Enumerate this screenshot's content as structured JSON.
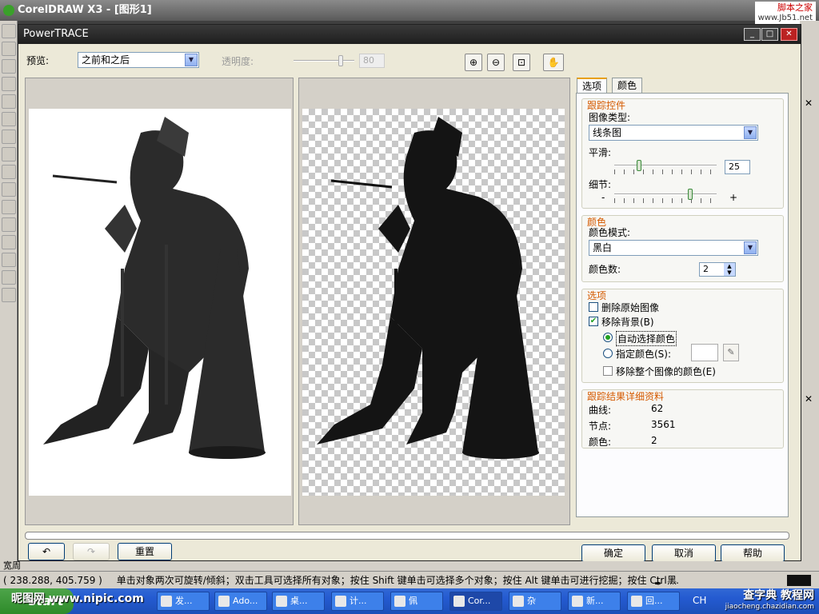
{
  "app": {
    "title": "CorelDRAW X3 - [图形1]",
    "watermark_top": "脚本之家",
    "watermark_url": "www.Jb51.net"
  },
  "dialog": {
    "title": "PowerTRACE",
    "preview_label": "预览:",
    "preview_value": "之前和之后",
    "transparency_label": "透明度:",
    "transparency_value": "80",
    "tabs": [
      "选项",
      "颜色"
    ],
    "trace_controls": {
      "title": "跟踪控件",
      "image_type_label": "图像类型:",
      "image_type_value": "线条图",
      "smoothing_label": "平滑:",
      "smoothing_value": "25",
      "detail_label": "细节:",
      "detail_minus": "-",
      "detail_plus": "+"
    },
    "color": {
      "title": "颜色",
      "mode_label": "颜色模式:",
      "mode_value": "黑白",
      "count_label": "颜色数:",
      "count_value": "2"
    },
    "options": {
      "title": "选项",
      "delete_original": "删除原始图像",
      "remove_background": "移除背景(B)",
      "auto_select": "自动选择颜色",
      "specify_color": "指定颜色(S):",
      "remove_entire": "移除整个图像的颜色(E)"
    },
    "results": {
      "title": "跟踪结果详细资料",
      "curves_label": "曲线:",
      "curves_value": "62",
      "nodes_label": "节点:",
      "nodes_value": "3561",
      "colors_label": "颜色:",
      "colors_value": "2"
    },
    "buttons": {
      "reset": "重置",
      "ok": "确定",
      "cancel": "取消",
      "help": "帮助"
    }
  },
  "below_dialog": "宽周",
  "status": {
    "coords": "( 238.288, 405.759 )",
    "hint": "单击对象两次可旋转/倾斜；双击工具可选择所有对象；按住 Shift 键单击可选择多个对象；按住 Alt 键单击可进行挖掘；按住 Ctrl ...",
    "color": "黑"
  },
  "taskbar": {
    "start": "start",
    "items": [
      "发...",
      "Ado...",
      "桌...",
      "计...",
      "佩",
      "Cor...",
      "杂",
      "新...",
      "回..."
    ],
    "tray": "CH"
  },
  "watermarks": {
    "bottom_left": "昵图网 www.nipic.com",
    "bottom_right": "查字典 教程网",
    "bottom_right_url": "jiaocheng.chazidian.com"
  }
}
